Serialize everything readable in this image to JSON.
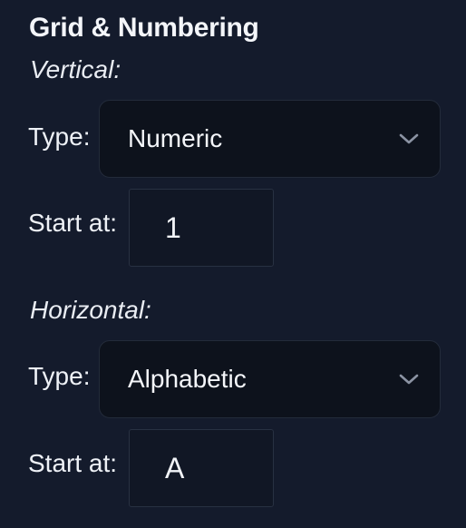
{
  "panel": {
    "title": "Grid & Numbering"
  },
  "vertical": {
    "heading": "Vertical:",
    "type_label": "Type:",
    "type_value": "Numeric",
    "start_label": "Start at:",
    "start_value": "1"
  },
  "horizontal": {
    "heading": "Horizontal:",
    "type_label": "Type:",
    "type_value": "Alphabetic",
    "start_label": "Start at:",
    "start_value": "A"
  },
  "icons": {
    "dropdown": "chevron-down-icon"
  },
  "colors": {
    "background": "#141b2c",
    "field_background": "#0d121c",
    "text": "#f1f3f7",
    "chevron": "#8b93a3"
  }
}
